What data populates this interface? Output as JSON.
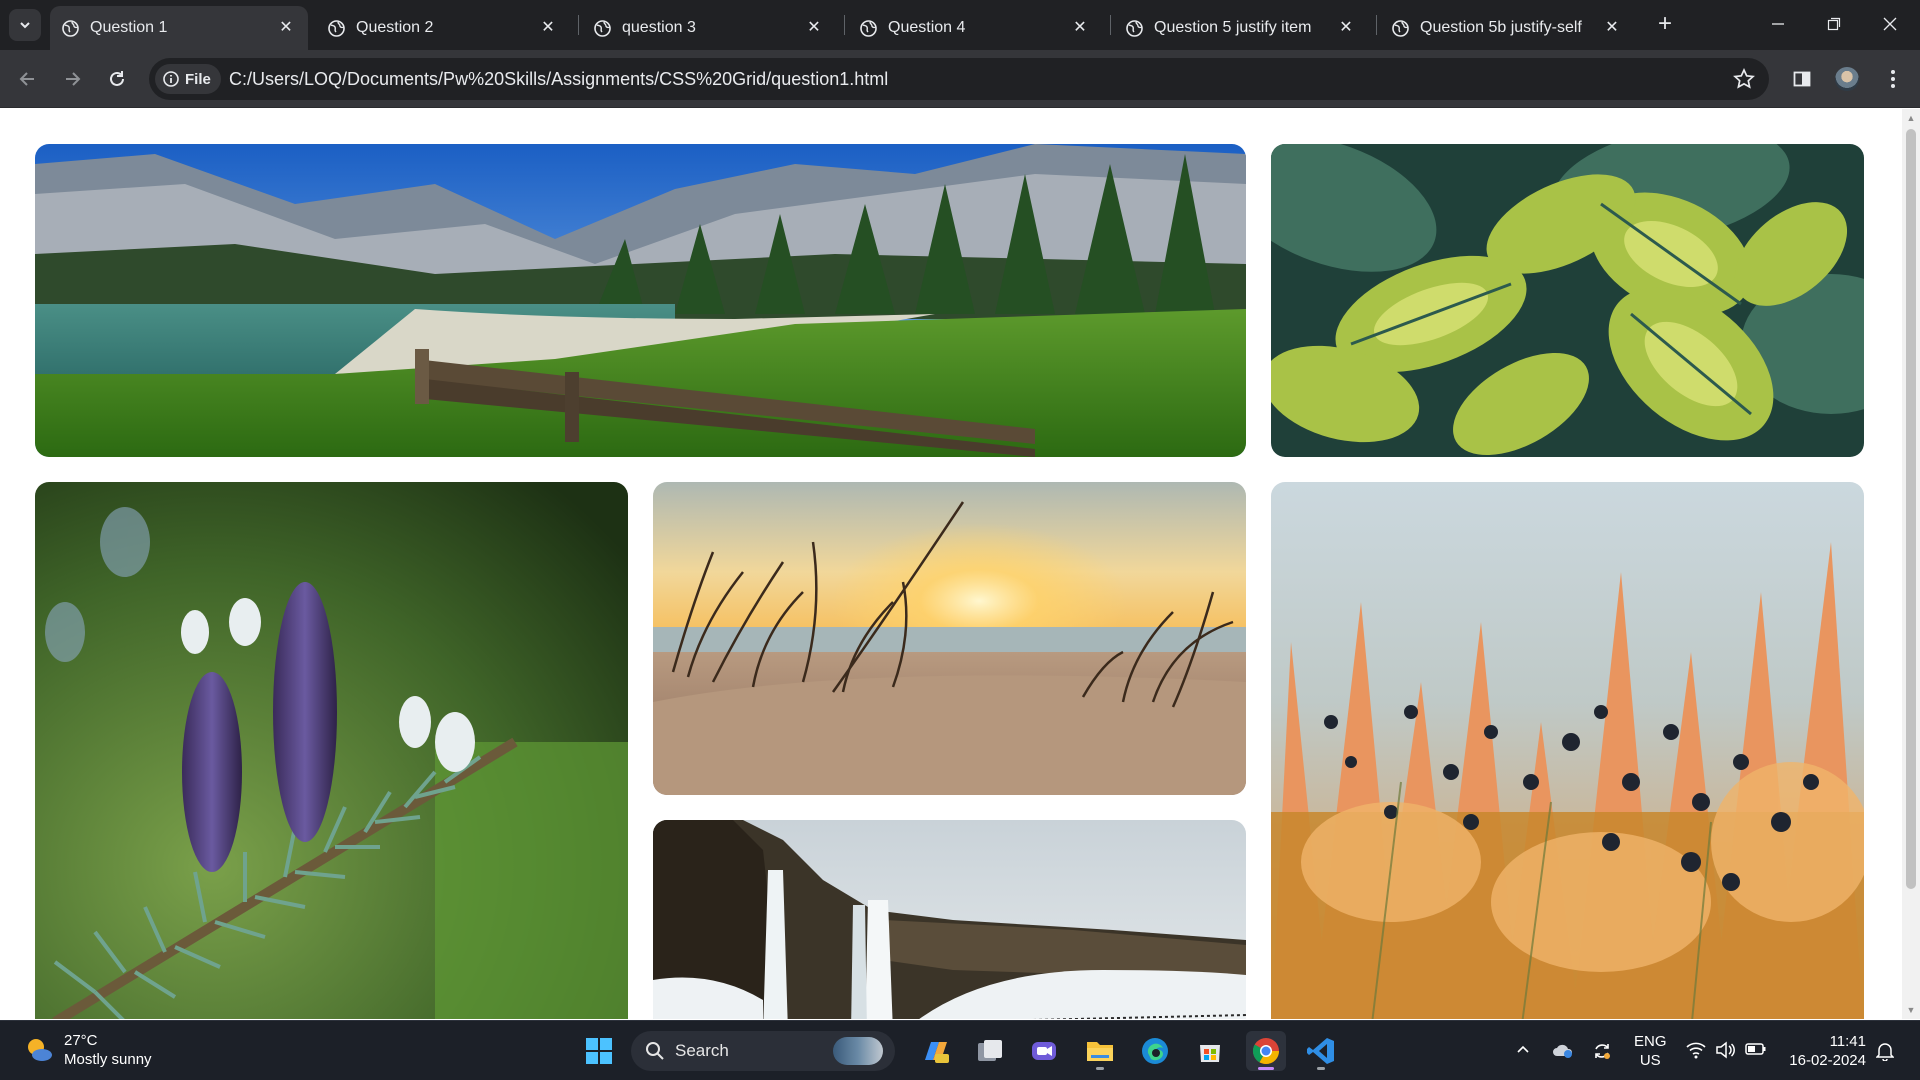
{
  "browser": {
    "tabs": [
      {
        "title": "Question 1",
        "active": true
      },
      {
        "title": "Question 2",
        "active": false
      },
      {
        "title": "question 3",
        "active": false
      },
      {
        "title": "Question 4",
        "active": false
      },
      {
        "title": "Question 5 justify item",
        "active": false
      },
      {
        "title": "Question 5b justify-self",
        "active": false
      }
    ],
    "address": {
      "scheme_chip": "File",
      "url": "C:/Users/LOQ/Documents/Pw%20Skills/Assignments/CSS%20Grid/question1.html"
    }
  },
  "page": {
    "gallery": [
      {
        "subject": "mountain lake meadow with wooden fence"
      },
      {
        "subject": "variegated hosta leaves"
      },
      {
        "subject": "purple fir cones on branch"
      },
      {
        "subject": "beach dune grass at sunset"
      },
      {
        "subject": "orange heather and blueberries"
      },
      {
        "subject": "waterfall over snowy cliffs"
      }
    ]
  },
  "taskbar": {
    "weather": {
      "temp": "27°C",
      "condition": "Mostly sunny"
    },
    "search_label": "Search",
    "language": {
      "line1": "ENG",
      "line2": "US"
    },
    "clock": {
      "time": "11:41",
      "date": "16-02-2024"
    }
  },
  "colors": {
    "tabstrip": "#202124",
    "toolbar": "#35363a",
    "taskbar": "#1c2028",
    "accent": "#c58af9"
  }
}
